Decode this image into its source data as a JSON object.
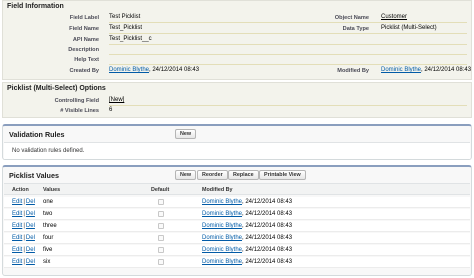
{
  "field_info": {
    "title": "Field Information",
    "field_label": {
      "label": "Field Label",
      "value": "Test Picklist"
    },
    "field_name": {
      "label": "Field Name",
      "value": "Test_Picklist"
    },
    "api_name": {
      "label": "API Name",
      "value": "Test_Picklist__c"
    },
    "description": {
      "label": "Description",
      "value": ""
    },
    "help_text": {
      "label": "Help Text",
      "value": ""
    },
    "created_by": {
      "label": "Created By",
      "user": "Dominic Blythe",
      "date": ", 24/12/2014 08:43"
    },
    "object_name": {
      "label": "Object Name",
      "value": "Customer"
    },
    "data_type": {
      "label": "Data Type",
      "value": "Picklist (Multi-Select)"
    },
    "modified_by": {
      "label": "Modified By",
      "user": "Dominic Blythe",
      "date": ", 24/12/2014 08:43"
    }
  },
  "picklist_options": {
    "title": "Picklist (Multi-Select) Options",
    "controlling_field": {
      "label": "Controlling Field",
      "value": "[New]"
    },
    "visible_lines": {
      "label": "# Visible Lines",
      "value": "6"
    }
  },
  "validation_rules": {
    "title": "Validation Rules",
    "new_button": "New",
    "empty_message": "No validation rules defined."
  },
  "picklist_values": {
    "title": "Picklist Values",
    "buttons": {
      "new": "New",
      "reorder": "Reorder",
      "replace": "Replace",
      "printable_view": "Printable View"
    },
    "columns": {
      "action": "Action",
      "values": "Values",
      "default": "Default",
      "modified_by": "Modified By"
    },
    "edit_label": "Edit",
    "sep": "|",
    "del_label": "Del",
    "rows": [
      {
        "value": "one",
        "default": false,
        "user": "Dominic Blythe",
        "date": ", 24/12/2014 08:43"
      },
      {
        "value": "two",
        "default": false,
        "user": "Dominic Blythe",
        "date": ", 24/12/2014 08:43"
      },
      {
        "value": "three",
        "default": false,
        "user": "Dominic Blythe",
        "date": ", 24/12/2014 08:43"
      },
      {
        "value": "four",
        "default": false,
        "user": "Dominic Blythe",
        "date": ", 24/12/2014 08:43"
      },
      {
        "value": "five",
        "default": false,
        "user": "Dominic Blythe",
        "date": ", 24/12/2014 08:43"
      },
      {
        "value": "six",
        "default": false,
        "user": "Dominic Blythe",
        "date": ", 24/12/2014 08:43"
      }
    ]
  }
}
